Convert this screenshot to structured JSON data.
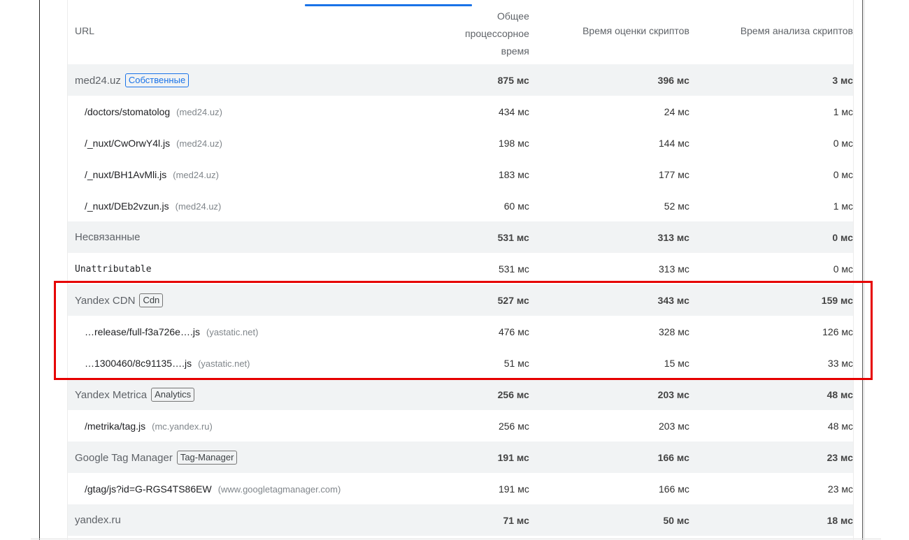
{
  "table": {
    "headers": {
      "url": "URL",
      "total_cpu_line1": "Общее",
      "total_cpu_line2": "процессорное",
      "total_cpu_line3": "время",
      "script_eval": "Время оценки скриптов",
      "script_parse": "Время анализа скриптов"
    },
    "rows": [
      {
        "kind": "group",
        "name": "med24.uz",
        "badge": "Собственные",
        "badge_style": "first-party",
        "total": "875 мс",
        "eval": "396 мс",
        "parse": "3 мс"
      },
      {
        "kind": "item",
        "path": "/doctors/stomatolog",
        "host": "(med24.uz)",
        "total": "434 мс",
        "eval": "24 мс",
        "parse": "1 мс"
      },
      {
        "kind": "item",
        "path": "/_nuxt/CwOrwY4l.js",
        "host": "(med24.uz)",
        "total": "198 мс",
        "eval": "144 мс",
        "parse": "0 мс"
      },
      {
        "kind": "item",
        "path": "/_nuxt/BH1AvMli.js",
        "host": "(med24.uz)",
        "total": "183 мс",
        "eval": "177 мс",
        "parse": "0 мс"
      },
      {
        "kind": "item",
        "path": "/_nuxt/DEb2vzun.js",
        "host": "(med24.uz)",
        "total": "60 мс",
        "eval": "52 мс",
        "parse": "1 мс"
      },
      {
        "kind": "group",
        "name": "Несвязанные",
        "badge": "",
        "total": "531 мс",
        "eval": "313 мс",
        "parse": "0 мс"
      },
      {
        "kind": "item-plain",
        "path": "Unattributable",
        "host": "",
        "total": "531 мс",
        "eval": "313 мс",
        "parse": "0 мс"
      },
      {
        "kind": "group",
        "name": "Yandex CDN",
        "badge": "Cdn",
        "total": "527 мс",
        "eval": "343 мс",
        "parse": "159 мс"
      },
      {
        "kind": "item",
        "path": "…release/full-f3a726e….js",
        "host": "(yastatic.net)",
        "total": "476 мс",
        "eval": "328 мс",
        "parse": "126 мс"
      },
      {
        "kind": "item",
        "path": "…1300460/8c91135….js",
        "host": "(yastatic.net)",
        "total": "51 мс",
        "eval": "15 мс",
        "parse": "33 мс"
      },
      {
        "kind": "group",
        "name": "Yandex Metrica",
        "badge": "Analytics",
        "total": "256 мс",
        "eval": "203 мс",
        "parse": "48 мс"
      },
      {
        "kind": "item",
        "path": "/metrika/tag.js",
        "host": "(mc.yandex.ru)",
        "total": "256 мс",
        "eval": "203 мс",
        "parse": "48 мс"
      },
      {
        "kind": "group",
        "name": "Google Tag Manager",
        "badge": "Tag-Manager",
        "total": "191 мс",
        "eval": "166 мс",
        "parse": "23 мс"
      },
      {
        "kind": "item",
        "path": "/gtag/js?id=G-RGS4TS86EW",
        "host": "(www.googletagmanager.com)",
        "total": "191 мс",
        "eval": "166 мс",
        "parse": "23 мс"
      },
      {
        "kind": "group",
        "name": "yandex.ru",
        "badge": "",
        "total": "71 мс",
        "eval": "50 мс",
        "parse": "18 мс"
      }
    ]
  },
  "colors": {
    "accent": "#1a73e8",
    "highlight": "#e60000",
    "group_row_bg": "#f1f3f4"
  }
}
